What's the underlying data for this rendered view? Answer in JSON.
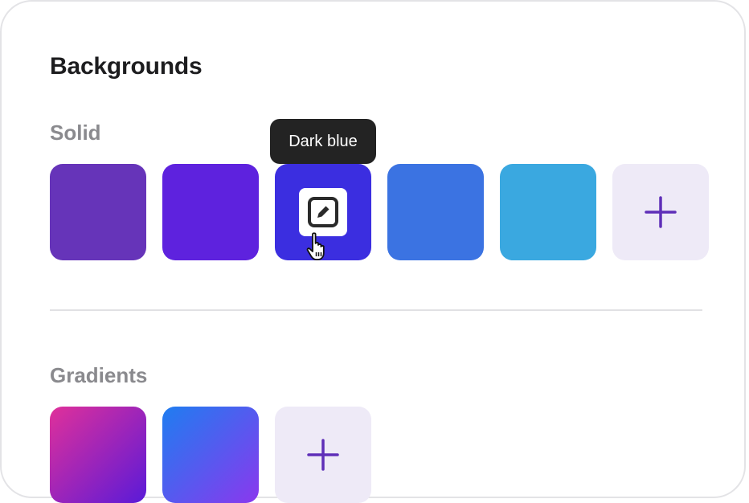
{
  "panel": {
    "title": "Backgrounds"
  },
  "solid": {
    "label": "Solid",
    "swatches": [
      {
        "name": "swatch-violet",
        "color": "#6634b9"
      },
      {
        "name": "swatch-purple",
        "color": "#5e22de"
      },
      {
        "name": "swatch-dark-blue",
        "color": "#3b2ee0",
        "hovered": true
      },
      {
        "name": "swatch-blue",
        "color": "#3b73e2"
      },
      {
        "name": "swatch-sky",
        "color": "#3aa8e0"
      }
    ],
    "add_icon": "plus-icon"
  },
  "tooltip": {
    "text": "Dark blue"
  },
  "edit": {
    "icon": "edit-icon"
  },
  "gradients": {
    "label": "Gradients",
    "swatches": [
      {
        "name": "gradient-magenta-purple",
        "from": "#e0309a",
        "to": "#5a1ad8"
      },
      {
        "name": "gradient-blue-violet",
        "from": "#1f7df0",
        "to": "#8a38ee"
      }
    ],
    "add_icon": "plus-icon"
  },
  "colors": {
    "accent": "#5f2fb8",
    "add_background": "#eeeaf7",
    "tooltip_background": "#232323"
  }
}
